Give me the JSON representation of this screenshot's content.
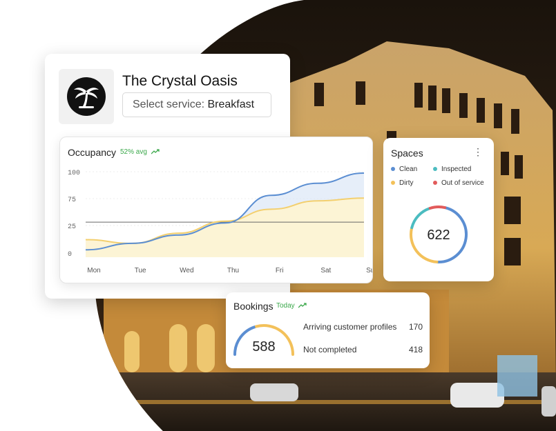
{
  "hotel": {
    "name": "The Crystal Oasis",
    "service_label": "Select service:",
    "service_value": "Breakfast"
  },
  "occupancy": {
    "title": "Occupancy",
    "avg_label": "52% avg",
    "trend_icon": "trend-up-icon"
  },
  "chart_data": {
    "type": "line",
    "categories": [
      "Mon",
      "Tue",
      "Wed",
      "Thu",
      "Fri",
      "Sat",
      "Sun"
    ],
    "y_ticks": [
      "100",
      "75",
      "25",
      "0"
    ],
    "series": [
      {
        "values": [
          8,
          15,
          24,
          37,
          67,
          80,
          91
        ],
        "color": "#5b8ed2"
      },
      {
        "values": [
          19,
          15,
          26,
          39,
          52,
          61,
          64
        ],
        "color": "#f3cf6e"
      }
    ],
    "reference_line": 38,
    "ylim": [
      0,
      100
    ],
    "grid": true
  },
  "spaces": {
    "title": "Spaces",
    "total": "622",
    "legend": [
      {
        "label": "Clean",
        "color": "#5b8ed2"
      },
      {
        "label": "Inspected",
        "color": "#4bbcc0"
      },
      {
        "label": "Dirty",
        "color": "#f3c15a"
      },
      {
        "label": "Out of service",
        "color": "#e25b5b"
      }
    ],
    "segments": [
      {
        "name": "Clean",
        "value": 0.47,
        "color": "#5b8ed2"
      },
      {
        "name": "Dirty",
        "value": 0.28,
        "color": "#f3c15a"
      },
      {
        "name": "Inspected",
        "value": 0.16,
        "color": "#4bbcc0"
      },
      {
        "name": "Out of service",
        "value": 0.09,
        "color": "#e25b5b"
      }
    ]
  },
  "bookings": {
    "title": "Bookings",
    "today_label": "Today",
    "total": "588",
    "gauge_fraction": 0.6,
    "rows": [
      {
        "label": "Arriving customer profiles",
        "value": "170"
      },
      {
        "label": "Not completed",
        "value": "418"
      }
    ]
  }
}
